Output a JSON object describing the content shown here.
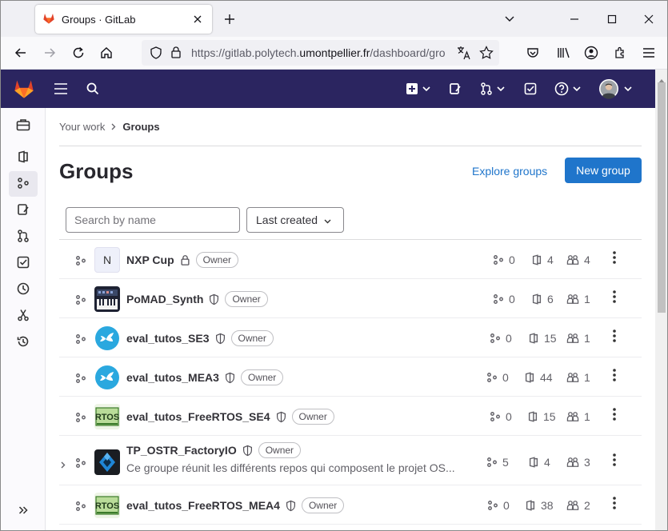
{
  "browser": {
    "tab_title": "Groups · GitLab",
    "url_prefix": "https://gitlab.polytech.",
    "url_domain": "umontpellier.fr",
    "url_suffix": "/dashboard/gro"
  },
  "breadcrumb": {
    "parent": "Your work",
    "current": "Groups"
  },
  "page": {
    "title": "Groups",
    "explore_label": "Explore groups",
    "new_group_label": "New group",
    "search_placeholder": "Search by name",
    "sort_label": "Last created"
  },
  "groups": [
    {
      "name": "NXP Cup",
      "avatar": "N",
      "visibility": "lock",
      "role": "Owner",
      "subgroups": "0",
      "projects": "4",
      "members": "4"
    },
    {
      "name": "PoMAD_Synth",
      "avatar": "synth",
      "visibility": "shield",
      "role": "Owner",
      "subgroups": "0",
      "projects": "6",
      "members": "1"
    },
    {
      "name": "eval_tutos_SE3",
      "avatar": "bird",
      "visibility": "shield",
      "role": "Owner",
      "subgroups": "0",
      "projects": "15",
      "members": "1"
    },
    {
      "name": "eval_tutos_MEA3",
      "avatar": "bird",
      "visibility": "shield",
      "role": "Owner",
      "subgroups": "0",
      "projects": "44",
      "members": "1"
    },
    {
      "name": "eval_tutos_FreeRTOS_SE4",
      "avatar": "rtos",
      "visibility": "shield",
      "role": "Owner",
      "subgroups": "0",
      "projects": "15",
      "members": "1"
    },
    {
      "name": "TP_OSTR_FactoryIO",
      "avatar": "factory",
      "visibility": "shield",
      "role": "Owner",
      "subgroups": "5",
      "projects": "4",
      "members": "3",
      "description": "Ce groupe réunit les différents repos qui composent le projet OS..."
    },
    {
      "name": "eval_tutos_FreeRTOS_MEA4",
      "avatar": "rtos",
      "visibility": "shield",
      "role": "Owner",
      "subgroups": "0",
      "projects": "38",
      "members": "2"
    }
  ],
  "colors": {
    "topbar": "#2b2560",
    "primary": "#1f75cb",
    "gitlab_orange": "#e24329"
  }
}
